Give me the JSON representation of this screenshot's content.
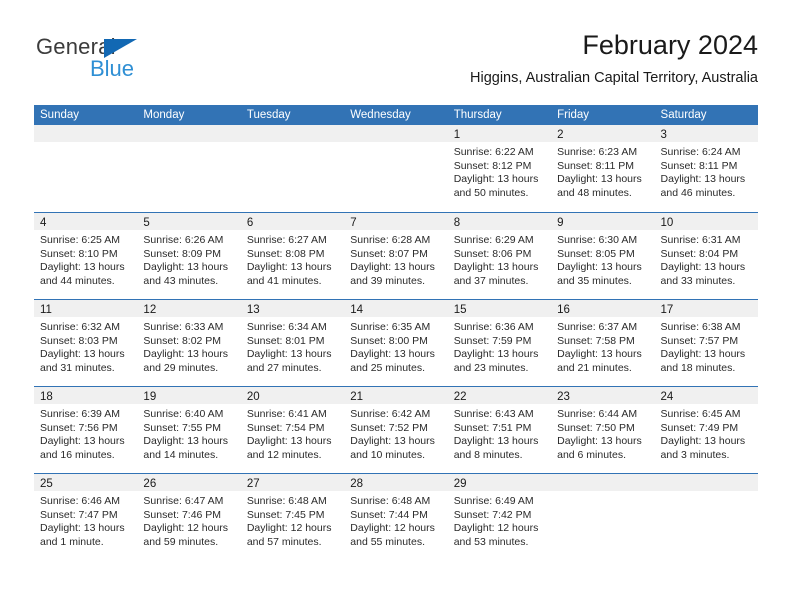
{
  "brand": {
    "name_part1": "General",
    "name_part2": "Blue",
    "triangle_icon": "logo-triangle-icon",
    "color_dark": "#3c3c3c",
    "color_blue": "#2f8fd4",
    "color_triangle": "#1268b3"
  },
  "header": {
    "title": "February 2024",
    "subtitle": "Higgins, Australian Capital Territory, Australia"
  },
  "theme": {
    "header_blue": "#3273b5",
    "day_band_gray": "#f0f0f0",
    "text": "#1a1a1a"
  },
  "weekdays": [
    "Sunday",
    "Monday",
    "Tuesday",
    "Wednesday",
    "Thursday",
    "Friday",
    "Saturday"
  ],
  "weeks": [
    [
      {
        "day": "",
        "lines": []
      },
      {
        "day": "",
        "lines": []
      },
      {
        "day": "",
        "lines": []
      },
      {
        "day": "",
        "lines": []
      },
      {
        "day": "1",
        "lines": [
          "Sunrise: 6:22 AM",
          "Sunset: 8:12 PM",
          "Daylight: 13 hours",
          "and 50 minutes."
        ]
      },
      {
        "day": "2",
        "lines": [
          "Sunrise: 6:23 AM",
          "Sunset: 8:11 PM",
          "Daylight: 13 hours",
          "and 48 minutes."
        ]
      },
      {
        "day": "3",
        "lines": [
          "Sunrise: 6:24 AM",
          "Sunset: 8:11 PM",
          "Daylight: 13 hours",
          "and 46 minutes."
        ]
      }
    ],
    [
      {
        "day": "4",
        "lines": [
          "Sunrise: 6:25 AM",
          "Sunset: 8:10 PM",
          "Daylight: 13 hours",
          "and 44 minutes."
        ]
      },
      {
        "day": "5",
        "lines": [
          "Sunrise: 6:26 AM",
          "Sunset: 8:09 PM",
          "Daylight: 13 hours",
          "and 43 minutes."
        ]
      },
      {
        "day": "6",
        "lines": [
          "Sunrise: 6:27 AM",
          "Sunset: 8:08 PM",
          "Daylight: 13 hours",
          "and 41 minutes."
        ]
      },
      {
        "day": "7",
        "lines": [
          "Sunrise: 6:28 AM",
          "Sunset: 8:07 PM",
          "Daylight: 13 hours",
          "and 39 minutes."
        ]
      },
      {
        "day": "8",
        "lines": [
          "Sunrise: 6:29 AM",
          "Sunset: 8:06 PM",
          "Daylight: 13 hours",
          "and 37 minutes."
        ]
      },
      {
        "day": "9",
        "lines": [
          "Sunrise: 6:30 AM",
          "Sunset: 8:05 PM",
          "Daylight: 13 hours",
          "and 35 minutes."
        ]
      },
      {
        "day": "10",
        "lines": [
          "Sunrise: 6:31 AM",
          "Sunset: 8:04 PM",
          "Daylight: 13 hours",
          "and 33 minutes."
        ]
      }
    ],
    [
      {
        "day": "11",
        "lines": [
          "Sunrise: 6:32 AM",
          "Sunset: 8:03 PM",
          "Daylight: 13 hours",
          "and 31 minutes."
        ]
      },
      {
        "day": "12",
        "lines": [
          "Sunrise: 6:33 AM",
          "Sunset: 8:02 PM",
          "Daylight: 13 hours",
          "and 29 minutes."
        ]
      },
      {
        "day": "13",
        "lines": [
          "Sunrise: 6:34 AM",
          "Sunset: 8:01 PM",
          "Daylight: 13 hours",
          "and 27 minutes."
        ]
      },
      {
        "day": "14",
        "lines": [
          "Sunrise: 6:35 AM",
          "Sunset: 8:00 PM",
          "Daylight: 13 hours",
          "and 25 minutes."
        ]
      },
      {
        "day": "15",
        "lines": [
          "Sunrise: 6:36 AM",
          "Sunset: 7:59 PM",
          "Daylight: 13 hours",
          "and 23 minutes."
        ]
      },
      {
        "day": "16",
        "lines": [
          "Sunrise: 6:37 AM",
          "Sunset: 7:58 PM",
          "Daylight: 13 hours",
          "and 21 minutes."
        ]
      },
      {
        "day": "17",
        "lines": [
          "Sunrise: 6:38 AM",
          "Sunset: 7:57 PM",
          "Daylight: 13 hours",
          "and 18 minutes."
        ]
      }
    ],
    [
      {
        "day": "18",
        "lines": [
          "Sunrise: 6:39 AM",
          "Sunset: 7:56 PM",
          "Daylight: 13 hours",
          "and 16 minutes."
        ]
      },
      {
        "day": "19",
        "lines": [
          "Sunrise: 6:40 AM",
          "Sunset: 7:55 PM",
          "Daylight: 13 hours",
          "and 14 minutes."
        ]
      },
      {
        "day": "20",
        "lines": [
          "Sunrise: 6:41 AM",
          "Sunset: 7:54 PM",
          "Daylight: 13 hours",
          "and 12 minutes."
        ]
      },
      {
        "day": "21",
        "lines": [
          "Sunrise: 6:42 AM",
          "Sunset: 7:52 PM",
          "Daylight: 13 hours",
          "and 10 minutes."
        ]
      },
      {
        "day": "22",
        "lines": [
          "Sunrise: 6:43 AM",
          "Sunset: 7:51 PM",
          "Daylight: 13 hours",
          "and 8 minutes."
        ]
      },
      {
        "day": "23",
        "lines": [
          "Sunrise: 6:44 AM",
          "Sunset: 7:50 PM",
          "Daylight: 13 hours",
          "and 6 minutes."
        ]
      },
      {
        "day": "24",
        "lines": [
          "Sunrise: 6:45 AM",
          "Sunset: 7:49 PM",
          "Daylight: 13 hours",
          "and 3 minutes."
        ]
      }
    ],
    [
      {
        "day": "25",
        "lines": [
          "Sunrise: 6:46 AM",
          "Sunset: 7:47 PM",
          "Daylight: 13 hours",
          "and 1 minute."
        ]
      },
      {
        "day": "26",
        "lines": [
          "Sunrise: 6:47 AM",
          "Sunset: 7:46 PM",
          "Daylight: 12 hours",
          "and 59 minutes."
        ]
      },
      {
        "day": "27",
        "lines": [
          "Sunrise: 6:48 AM",
          "Sunset: 7:45 PM",
          "Daylight: 12 hours",
          "and 57 minutes."
        ]
      },
      {
        "day": "28",
        "lines": [
          "Sunrise: 6:48 AM",
          "Sunset: 7:44 PM",
          "Daylight: 12 hours",
          "and 55 minutes."
        ]
      },
      {
        "day": "29",
        "lines": [
          "Sunrise: 6:49 AM",
          "Sunset: 7:42 PM",
          "Daylight: 12 hours",
          "and 53 minutes."
        ]
      },
      {
        "day": "",
        "lines": []
      },
      {
        "day": "",
        "lines": []
      }
    ]
  ]
}
